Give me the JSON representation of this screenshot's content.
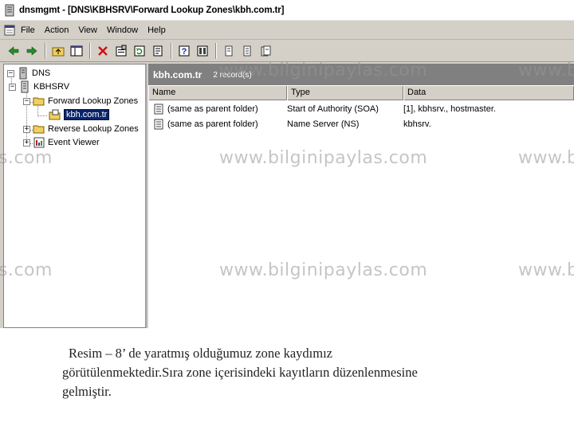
{
  "window": {
    "title": "dnsmgmt - [DNS\\KBHSRV\\Forward Lookup Zones\\kbh.com.tr]"
  },
  "menu": {
    "items": [
      "File",
      "Action",
      "View",
      "Window",
      "Help"
    ]
  },
  "toolbar": {
    "icons": [
      "back-icon",
      "forward-icon",
      "up-folder-icon",
      "show-hide-tree-icon",
      "delete-icon",
      "properties-icon",
      "refresh-icon",
      "export-list-icon",
      "help-icon",
      "console-icon",
      "new-host-icon",
      "new-alias-icon",
      "new-mail-exchanger-icon"
    ]
  },
  "tree": {
    "root": "DNS",
    "server": "KBHSRV",
    "forward_zones": "Forward Lookup Zones",
    "selected_zone": "kbh.com.tr",
    "reverse_zones": "Reverse Lookup Zones",
    "event_viewer": "Event Viewer"
  },
  "list": {
    "zone_name": "kbh.com.tr",
    "record_count": "2 record(s)",
    "columns": [
      "Name",
      "Type",
      "Data"
    ],
    "rows": [
      {
        "name": "(same as parent folder)",
        "type": "Start of Authority (SOA)",
        "data": "[1], kbhsrv., hostmaster."
      },
      {
        "name": "(same as parent folder)",
        "type": "Name Server (NS)",
        "data": "kbhsrv."
      }
    ]
  },
  "watermarks": [
    "www.bilginipaylas.com",
    "s.com",
    "www.b"
  ],
  "caption": {
    "line1": "Resim – 8’ de yaratmış olduğumuz zone kaydımız",
    "line2": "görütülenmektedir.Sıra zone içerisindeki kayıtların düzenlenmesine",
    "line3": "gelmiştir."
  },
  "colors": {
    "window_bg": "#d4d0c8",
    "header_bar": "#808080",
    "selection": "#0a246a"
  }
}
